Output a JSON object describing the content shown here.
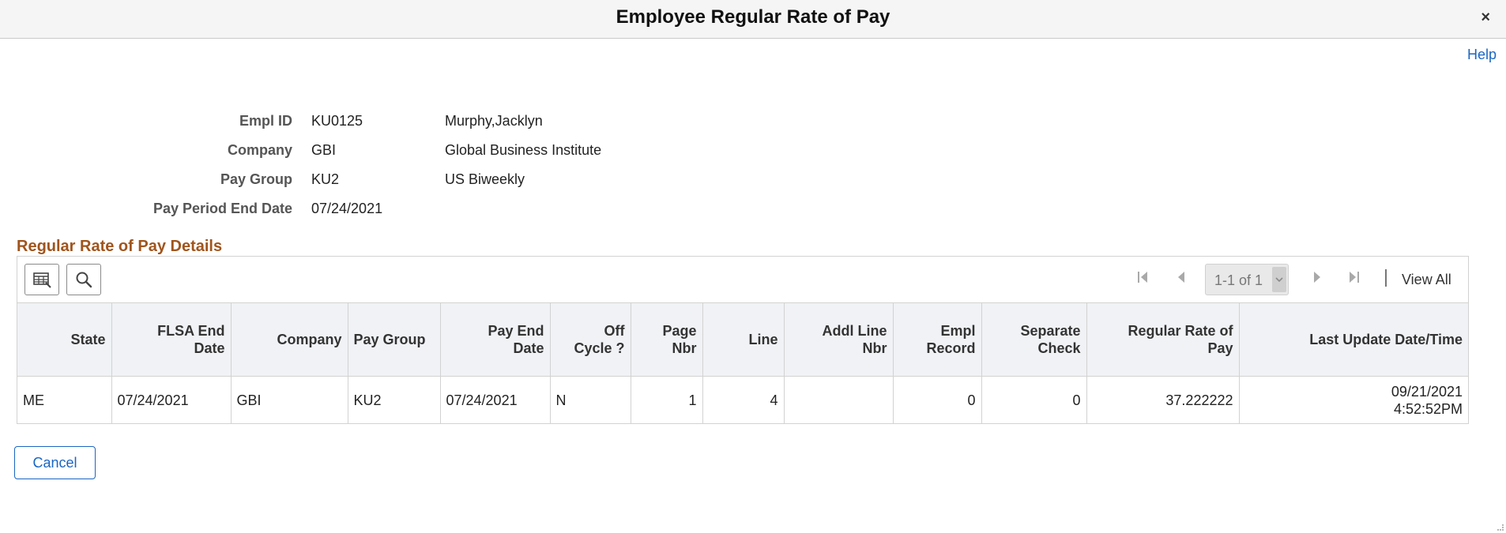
{
  "dialog": {
    "title": "Employee Regular Rate of Pay",
    "close_glyph": "×",
    "help_label": "Help"
  },
  "header": {
    "empl_id": {
      "label": "Empl ID",
      "value": "KU0125",
      "description": "Murphy,Jacklyn"
    },
    "company": {
      "label": "Company",
      "value": "GBI",
      "description": "Global Business Institute"
    },
    "pay_group": {
      "label": "Pay Group",
      "value": "KU2",
      "description": "US Biweekly"
    },
    "pay_period_end_date": {
      "label": "Pay Period End Date",
      "value": "07/24/2021"
    }
  },
  "section": {
    "title": "Regular Rate of Pay Details",
    "accent_color": "#a0541c"
  },
  "grid_toolbar": {
    "icons": [
      "personalize-grid-icon",
      "search-icon",
      "first-page-icon",
      "previous-page-icon",
      "next-page-icon",
      "last-page-icon"
    ],
    "pager_text": "1-1 of 1",
    "view_all_label": "View All"
  },
  "columns": {
    "state": "State",
    "flsa_end_date_1": "FLSA End",
    "flsa_end_date_2": "Date",
    "company": "Company",
    "pay_group": "Pay Group",
    "pay_end_date_1": "Pay End",
    "pay_end_date_2": "Date",
    "off_cycle_1": "Off",
    "off_cycle_2": "Cycle ?",
    "page_nbr_1": "Page",
    "page_nbr_2": "Nbr",
    "line": "Line",
    "addl_line_nbr_1": "Addl Line",
    "addl_line_nbr_2": "Nbr",
    "empl_record_1": "Empl",
    "empl_record_2": "Record",
    "separate_check_1": "Separate",
    "separate_check_2": "Check",
    "regular_rate_of_pay_1": "Regular Rate of",
    "regular_rate_of_pay_2": "Pay",
    "last_update": "Last Update Date/Time"
  },
  "rows": [
    {
      "state": "ME",
      "flsa_end_date": "07/24/2021",
      "company": "GBI",
      "pay_group": "KU2",
      "pay_end_date": "07/24/2021",
      "off_cycle": "N",
      "page_nbr": "1",
      "line": "4",
      "addl_line_nbr": "",
      "empl_record": "0",
      "separate_check": "0",
      "regular_rate_of_pay": "37.222222",
      "last_update_date": "09/21/2021",
      "last_update_time": "4:52:52PM"
    }
  ],
  "footer": {
    "cancel_label": "Cancel"
  },
  "colors": {
    "link": "#1a66c2",
    "header_bg": "#f0f2f5",
    "title_bar_bg": "#f5f5f5"
  }
}
